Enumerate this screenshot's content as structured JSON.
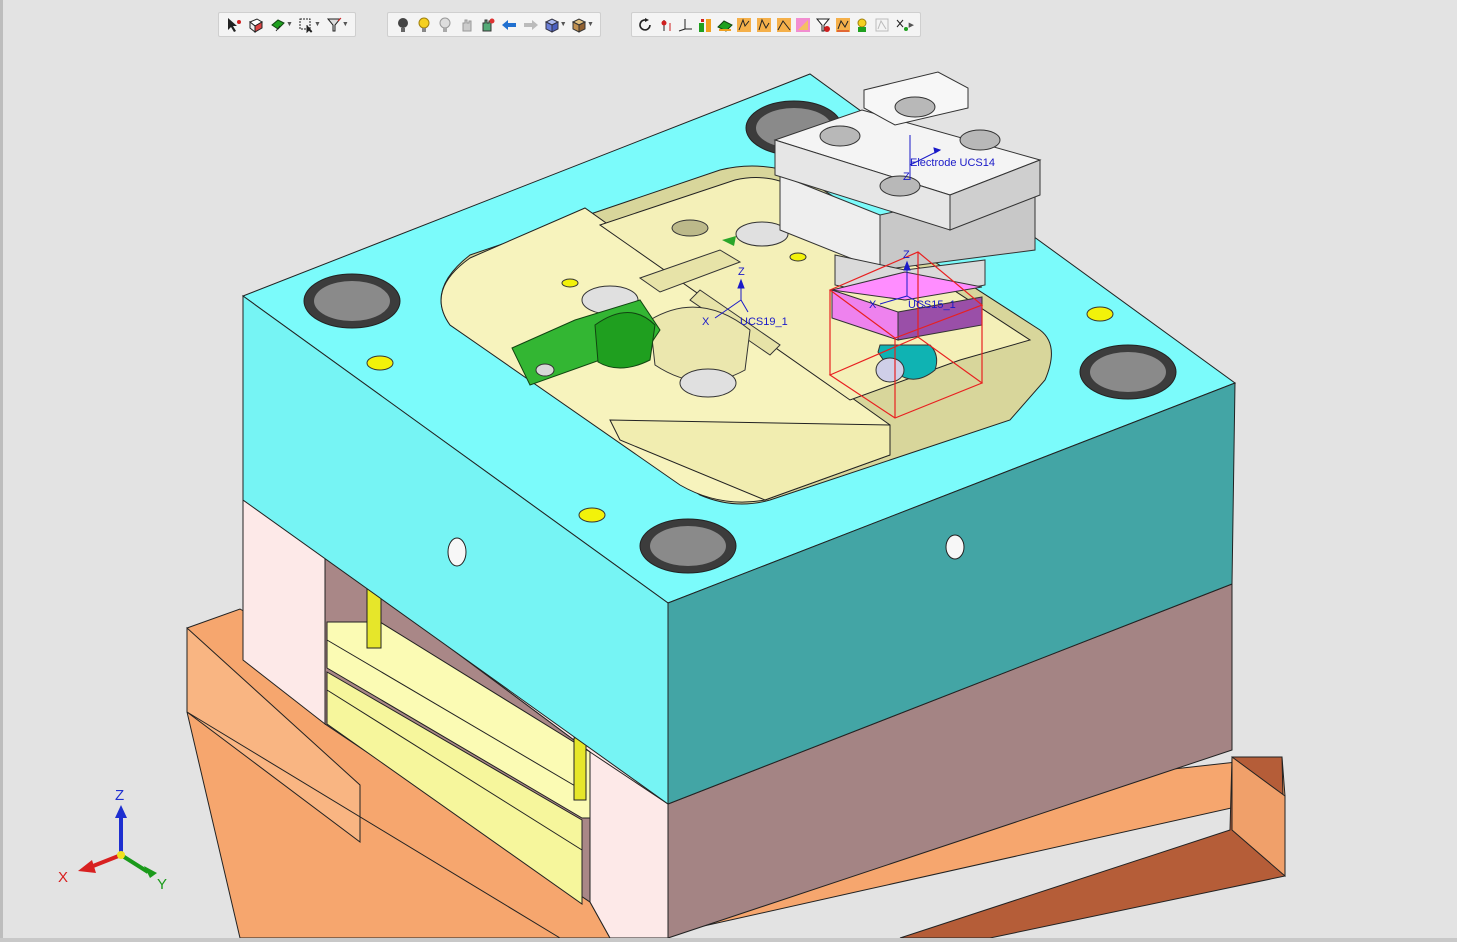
{
  "toolbars": {
    "selection": [
      {
        "icon": "select-cursor-icon"
      },
      {
        "icon": "select-face-icon"
      },
      {
        "icon": "select-filter-icon",
        "dropdown": true
      },
      {
        "icon": "box-select-icon",
        "dropdown": true
      },
      {
        "icon": "pick-filter-icon",
        "dropdown": true
      }
    ],
    "display": [
      {
        "icon": "light-bulb-dark-icon"
      },
      {
        "icon": "light-bulb-on-icon"
      },
      {
        "icon": "light-bulb-off-icon"
      },
      {
        "icon": "hide-hand-icon"
      },
      {
        "icon": "show-hand-icon"
      },
      {
        "icon": "previous-view-arrow-icon"
      },
      {
        "icon": "next-view-arrow-icon"
      },
      {
        "icon": "view-cube-icon",
        "dropdown": true
      },
      {
        "icon": "render-mode-icon",
        "dropdown": true
      }
    ],
    "tools": [
      {
        "icon": "rotate-icon"
      },
      {
        "icon": "measure-point-icon"
      },
      {
        "icon": "axis-triad-icon"
      },
      {
        "icon": "electrode-icon"
      },
      {
        "icon": "electrode-extend-icon"
      },
      {
        "icon": "electrode-profile-icon"
      },
      {
        "icon": "electrode-holder-icon"
      },
      {
        "icon": "electrode-face-icon"
      },
      {
        "icon": "electrode-burn-icon"
      },
      {
        "icon": "electrode-sheet-icon"
      },
      {
        "icon": "electrode-burn-check-icon"
      },
      {
        "icon": "electrode-report-icon"
      },
      {
        "icon": "electrode-disabled-icon"
      },
      {
        "icon": "more-tools-icon",
        "dropdown": true
      }
    ]
  },
  "ucs_labels": {
    "electrode": "Electrode UCS14",
    "ucs19": "UCS19_1",
    "ucs15": "UCS15_1",
    "axis_x": "X",
    "axis_z": "Z"
  },
  "triad": {
    "x": "X",
    "y": "Y",
    "z": "Z"
  },
  "colors": {
    "plate_top": "#7bfbfb",
    "plate_side": "#43a5a5",
    "plate_front": "#76f4f4",
    "core_insert": "#f7f3bd",
    "electrode_head": "#f0f0f0",
    "electrode_base": "#ee82ee",
    "clamp_plate": "#f6a66e",
    "spacer": "#fde9e8",
    "lower_block": "#a48484",
    "ejector_plate": "#fbfbb4"
  }
}
